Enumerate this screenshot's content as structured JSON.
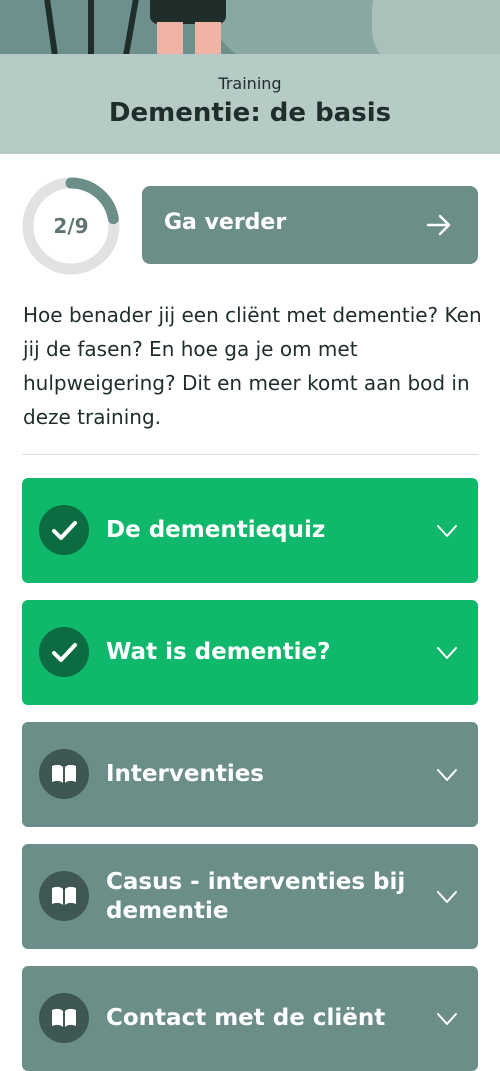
{
  "header": {
    "subtitle": "Training",
    "title": "Dementie: de basis"
  },
  "progress": {
    "label": "2/9",
    "completed": 2,
    "total": 9
  },
  "continue_button": {
    "label": "Ga verder",
    "icon": "arrow-right-icon"
  },
  "description": "Hoe benader jij een cliënt met dementie? Ken jij de fasen? En hoe ga je om met hulpweigering? Dit en meer komt aan bod in deze training.",
  "modules": [
    {
      "label": "De dementiequiz",
      "status": "completed",
      "icon": "check-icon"
    },
    {
      "label": "Wat is dementie?",
      "status": "completed",
      "icon": "check-icon"
    },
    {
      "label": "Interventies",
      "status": "not-started",
      "icon": "book-icon"
    },
    {
      "label": "Casus - interventies bij dementie",
      "status": "not-started",
      "icon": "book-icon"
    },
    {
      "label": "Contact met de cliënt",
      "status": "not-started",
      "icon": "book-icon"
    }
  ],
  "colors": {
    "completed": "#0fb86a",
    "pending": "#6b8e89",
    "header_bg": "#b6cac6",
    "text": "#1f2d2b"
  }
}
